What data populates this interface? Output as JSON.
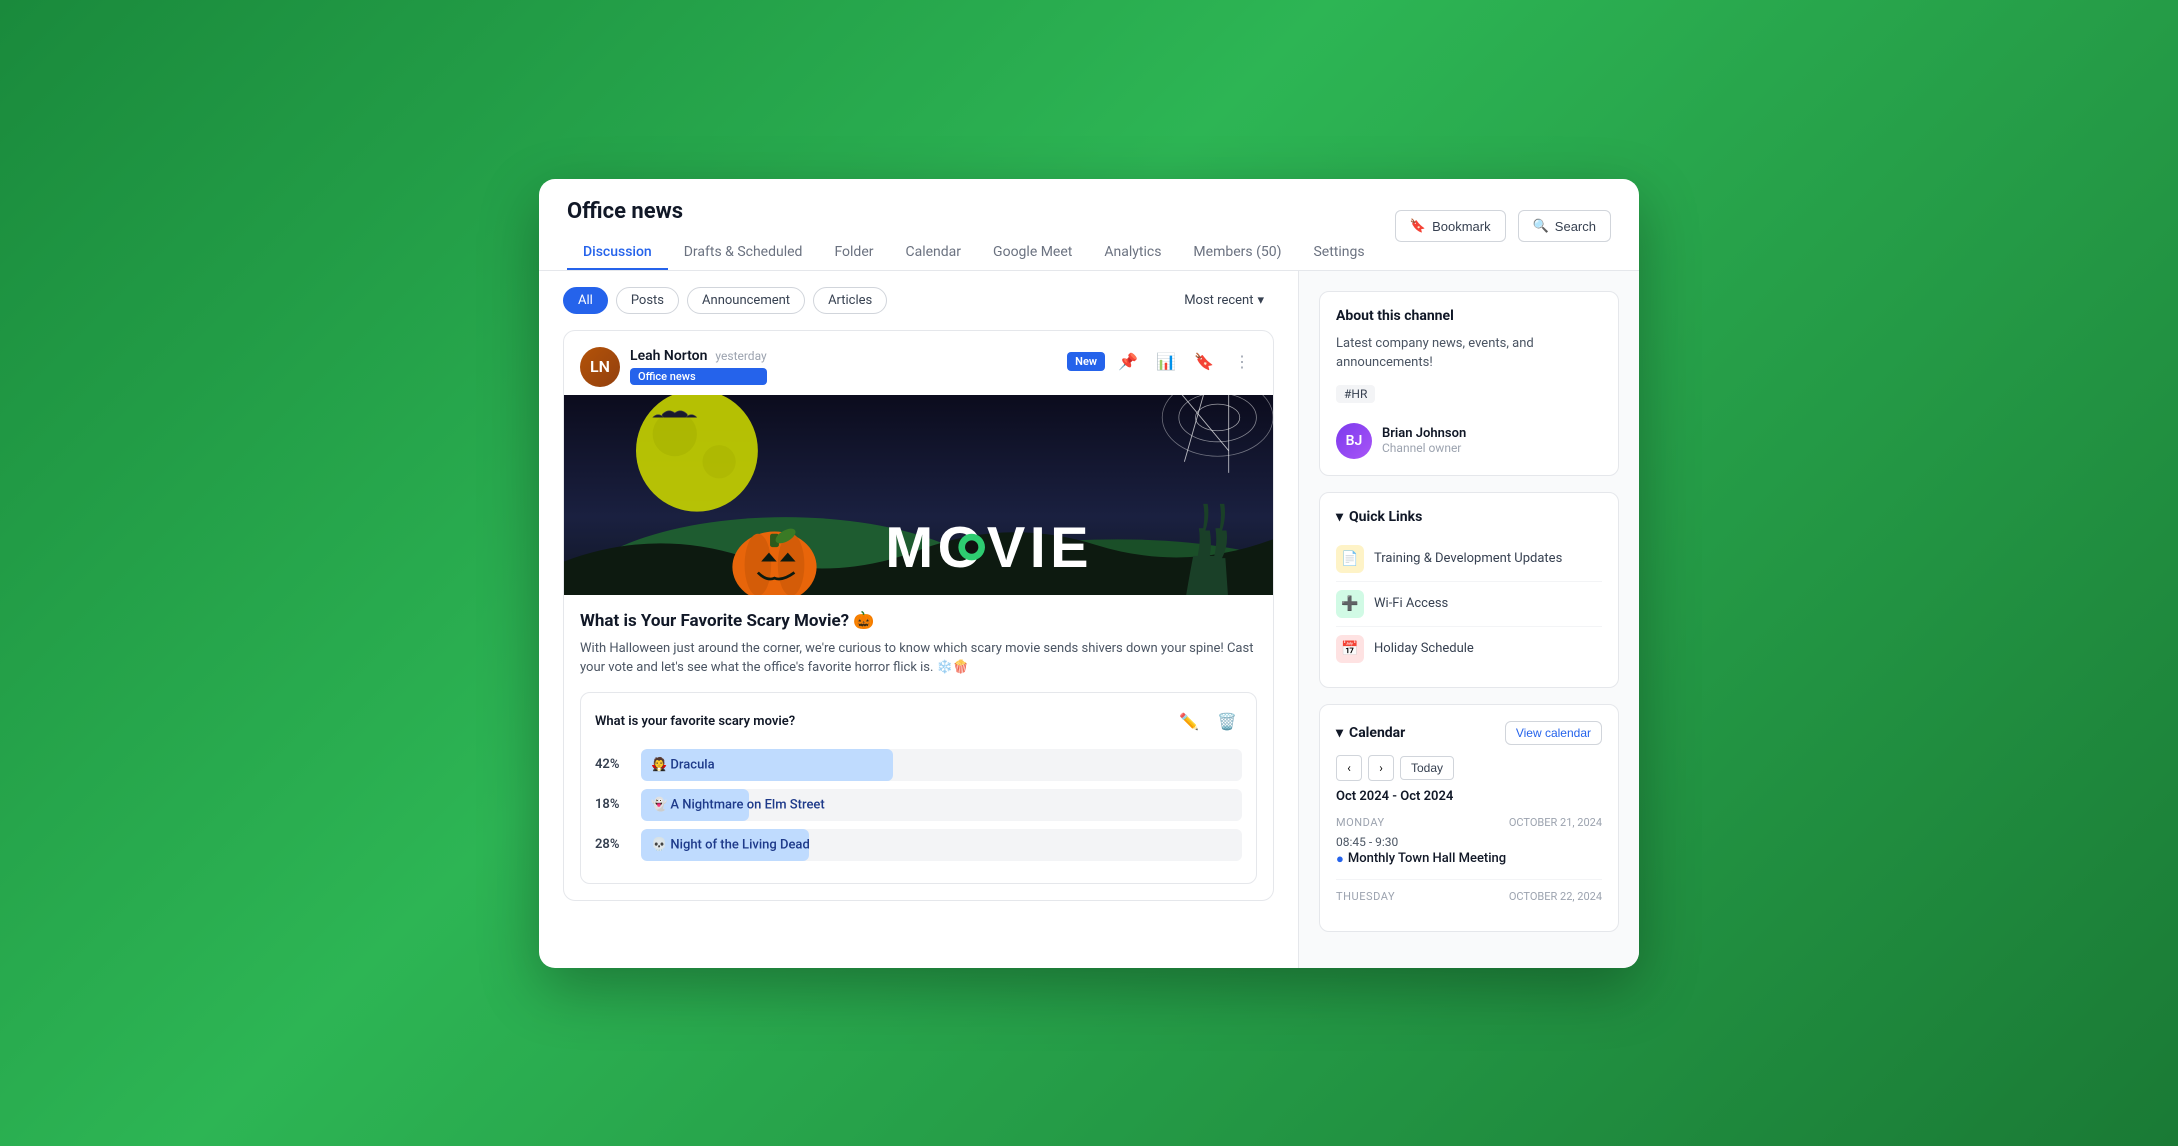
{
  "header": {
    "title": "Office news",
    "tabs": [
      {
        "label": "Discussion",
        "active": true
      },
      {
        "label": "Drafts & Scheduled",
        "active": false
      },
      {
        "label": "Folder",
        "active": false
      },
      {
        "label": "Calendar",
        "active": false
      },
      {
        "label": "Google Meet",
        "active": false
      },
      {
        "label": "Analytics",
        "active": false
      },
      {
        "label": "Members (50)",
        "active": false
      },
      {
        "label": "Settings",
        "active": false
      }
    ],
    "bookmark_label": "Bookmark",
    "search_label": "Search"
  },
  "filters": {
    "chips": [
      {
        "label": "All",
        "active": true
      },
      {
        "label": "Posts",
        "active": false
      },
      {
        "label": "Announcement",
        "active": false
      },
      {
        "label": "Articles",
        "active": false
      }
    ],
    "sort_label": "Most recent"
  },
  "post": {
    "author_name": "Leah Norton",
    "author_initials": "LN",
    "post_time": "yesterday",
    "channel_tag": "Office news",
    "badge_new": "New",
    "image_alt": "Halloween movie themed banner",
    "title": "What is Your Favorite Scary Movie? 🎃",
    "body": "With Halloween just around the corner, we're curious to know which scary movie sends shivers down your spine! Cast your vote and let's see what the office's favorite horror flick is. ❄️🍿",
    "poll": {
      "question": "What is your favorite scary movie?",
      "options": [
        {
          "pct": 42,
          "label": "🧛 Dracula"
        },
        {
          "pct": 18,
          "label": "👻 A Nightmare on Elm Street"
        },
        {
          "pct": 28,
          "label": "💀 Night of the Living Dead"
        }
      ]
    }
  },
  "sidebar": {
    "about": {
      "title": "About this channel",
      "description": "Latest company news, events, and announcements!",
      "tag": "#HR",
      "owner_name": "Brian Johnson",
      "owner_role": "Channel owner",
      "owner_initials": "BJ"
    },
    "quick_links": {
      "title": "Quick Links",
      "items": [
        {
          "label": "Training & Development Updates",
          "icon": "📄",
          "color": "yellow"
        },
        {
          "label": "Wi-Fi Access",
          "icon": "➕",
          "color": "green"
        },
        {
          "label": "Holiday Schedule",
          "icon": "📅",
          "color": "red"
        }
      ]
    },
    "calendar": {
      "title": "Calendar",
      "view_label": "View calendar",
      "range": "Oct 2024 - Oct 2024",
      "today_label": "Today",
      "days": [
        {
          "day_name": "MONDAY",
          "date": "OCTOBER 21, 2024",
          "events": [
            {
              "time": "08:45 - 9:30",
              "title": "Monthly Town Hall Meeting"
            }
          ]
        },
        {
          "day_name": "THUESDAY",
          "date": "OCTOBER 22, 2024",
          "events": []
        }
      ]
    }
  }
}
